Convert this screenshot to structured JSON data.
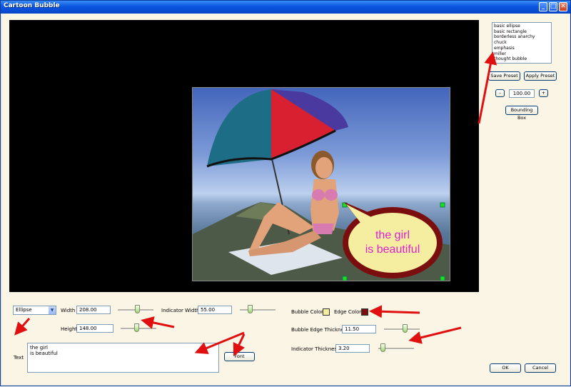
{
  "window": {
    "title": "Cartoon Bubble"
  },
  "titlebar_buttons": {
    "minimize": "_",
    "maximize": "□",
    "close": "✕"
  },
  "presets": {
    "items": [
      "basic ellipse",
      "basic rectangle",
      "borderless anarchy",
      "chuck",
      "emphasis",
      "miller",
      "thought bubble"
    ],
    "save_label": "Save Preset",
    "apply_label": "Apply Preset",
    "minus_label": "-",
    "plus_label": "+",
    "zoom_value": "100.00",
    "bounding_box_label": "Bounding Box"
  },
  "bubble": {
    "text_line1": "the girl",
    "text_line2": "is beautiful",
    "text_color": "#e020d0",
    "fill_color": "#f5eea0",
    "edge_color": "#7a0e0e"
  },
  "controls": {
    "shape": "Ellipse",
    "width_label": "Width",
    "width_value": "208.00",
    "width_slider": 0.55,
    "height_label": "Height",
    "height_value": "148.00",
    "height_slider": 0.45,
    "indicator_width_label": "Indicator Width",
    "indicator_width_value": "55.00",
    "indicator_width_slider": 0.25,
    "text_label": "Text",
    "text_line1": "the girl",
    "text_line2": "is beautiful",
    "font_label": "Font",
    "bubble_color_label": "Bubble Color",
    "edge_color_label": "Edge Color",
    "edge_thickness_label": "Bubble Edge Thickness",
    "edge_thickness_value": "11.50",
    "edge_thickness_slider": 0.6,
    "indicator_thickness_label": "Indicator Thickness",
    "indicator_thickness_value": "3.20",
    "indicator_thickness_slider": 0.08,
    "ok_label": "OK",
    "cancel_label": "Cancel"
  },
  "colors": {
    "annotation_arrow": "#e01010",
    "canvas_bg": "#000000"
  }
}
